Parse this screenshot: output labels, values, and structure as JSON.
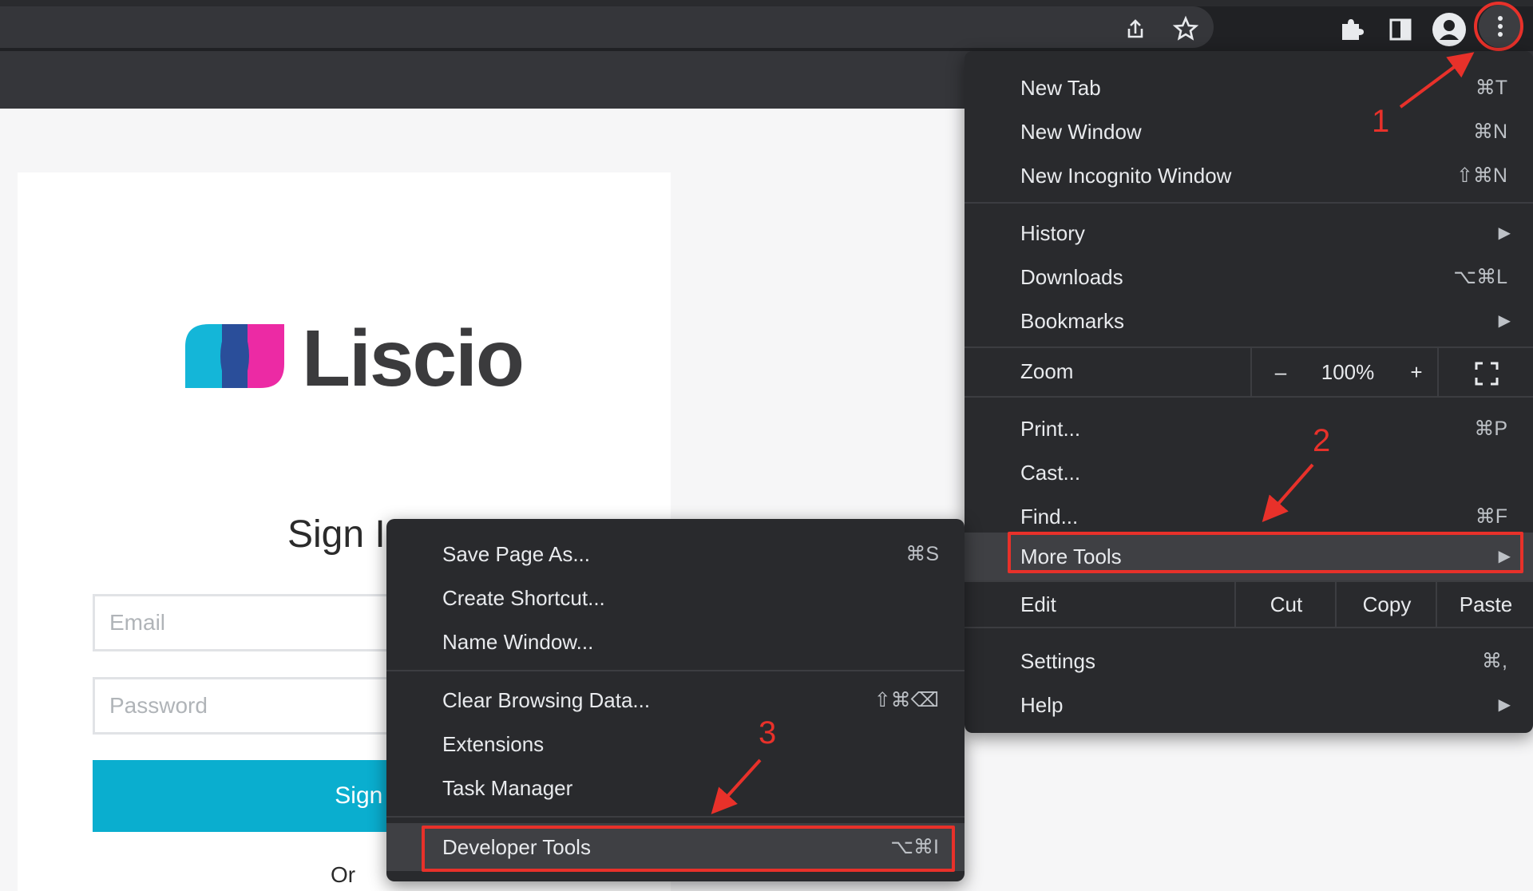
{
  "toolbar": {
    "icons": [
      "share-icon",
      "star-icon",
      "extensions-icon",
      "side-panel-icon",
      "profile-icon",
      "kebab-menu-icon"
    ]
  },
  "page": {
    "logo_text": "Liscio",
    "heading": "Sign In",
    "email_placeholder": "Email",
    "password_placeholder": "Password",
    "signin_button": "Sign In",
    "or_text": "Or"
  },
  "main_menu": {
    "new_tab": {
      "label": "New Tab",
      "shortcut": "⌘T"
    },
    "new_window": {
      "label": "New Window",
      "shortcut": "⌘N"
    },
    "new_incognito": {
      "label": "New Incognito Window",
      "shortcut": "⇧⌘N"
    },
    "history": {
      "label": "History"
    },
    "downloads": {
      "label": "Downloads",
      "shortcut": "⌥⌘L"
    },
    "bookmarks": {
      "label": "Bookmarks"
    },
    "zoom": {
      "label": "Zoom",
      "minus": "–",
      "value": "100%",
      "plus": "+"
    },
    "print": {
      "label": "Print...",
      "shortcut": "⌘P"
    },
    "cast": {
      "label": "Cast..."
    },
    "find": {
      "label": "Find...",
      "shortcut": "⌘F"
    },
    "more_tools": {
      "label": "More Tools"
    },
    "edit": {
      "label": "Edit",
      "cut": "Cut",
      "copy": "Copy",
      "paste": "Paste"
    },
    "settings": {
      "label": "Settings",
      "shortcut": "⌘,"
    },
    "help": {
      "label": "Help"
    }
  },
  "sub_menu": {
    "save_page": {
      "label": "Save Page As...",
      "shortcut": "⌘S"
    },
    "create_shortcut": {
      "label": "Create Shortcut..."
    },
    "name_window": {
      "label": "Name Window..."
    },
    "clear_data": {
      "label": "Clear Browsing Data...",
      "shortcut": "⇧⌘⌫"
    },
    "extensions": {
      "label": "Extensions"
    },
    "task_manager": {
      "label": "Task Manager"
    },
    "developer_tools": {
      "label": "Developer Tools",
      "shortcut": "⌥⌘I"
    }
  },
  "annotations": {
    "step1": "1",
    "step2": "2",
    "step3": "3",
    "color": "#e8312a"
  }
}
